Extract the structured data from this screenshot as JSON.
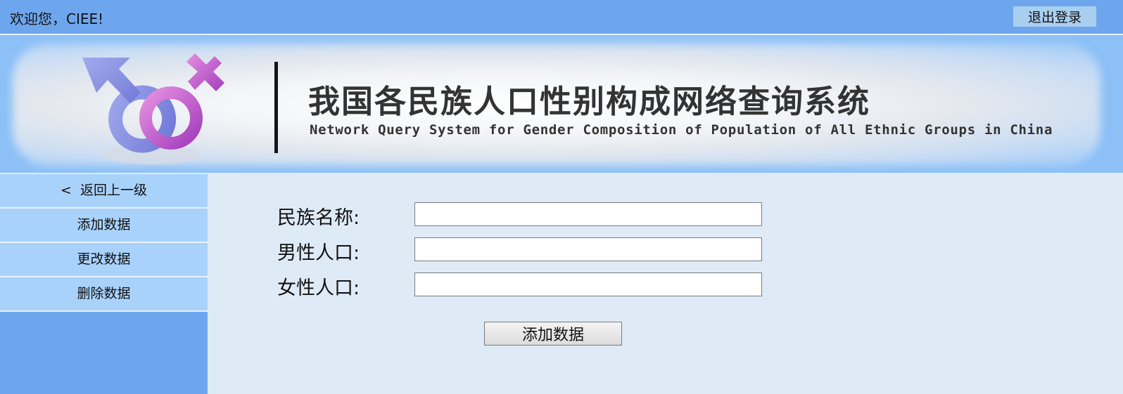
{
  "header": {
    "welcome_text": "欢迎您，CIEE!",
    "logout_label": "退出登录"
  },
  "banner": {
    "title": "我国各民族人口性别构成网络查询系统",
    "subtitle": "Network Query System for Gender Composition of Population of All Ethnic Groups in China",
    "logo_icon": "gender-symbols-icon"
  },
  "sidebar": {
    "back_arrow": "<",
    "back_label": "返回上一级",
    "items": [
      {
        "label": "添加数据"
      },
      {
        "label": "更改数据"
      },
      {
        "label": "删除数据"
      }
    ]
  },
  "form": {
    "fields": [
      {
        "label": "民族名称:",
        "value": ""
      },
      {
        "label": "男性人口:",
        "value": ""
      },
      {
        "label": "女性人口:",
        "value": ""
      }
    ],
    "submit_label": "添加数据"
  },
  "colors": {
    "topbar": "#6ea6ee",
    "sidebar_item": "#a9d2fb",
    "content_bg": "#deebf7",
    "logout_button": "#a9cff0"
  }
}
